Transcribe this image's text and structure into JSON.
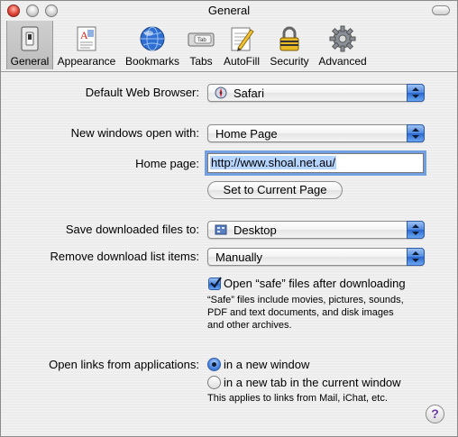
{
  "window": {
    "title": "General"
  },
  "toolbar": {
    "items": [
      {
        "label": "General",
        "icon": "switch-icon"
      },
      {
        "label": "Appearance",
        "icon": "appearance-icon"
      },
      {
        "label": "Bookmarks",
        "icon": "globe-icon"
      },
      {
        "label": "Tabs",
        "icon": "tabs-icon"
      },
      {
        "label": "AutoFill",
        "icon": "autofill-pencil-icon"
      },
      {
        "label": "Security",
        "icon": "lock-icon"
      },
      {
        "label": "Advanced",
        "icon": "gear-icon"
      }
    ],
    "tab_icon_text": "Tab"
  },
  "settings": {
    "default_browser": {
      "label": "Default Web Browser:",
      "value": "Safari"
    },
    "new_windows": {
      "label": "New windows open with:",
      "value": "Home Page"
    },
    "home_page": {
      "label": "Home page:",
      "value": "http://www.shoal.net.au/"
    },
    "set_current_button": "Set to Current Page",
    "save_downloads": {
      "label": "Save downloaded files to:",
      "value": "Desktop"
    },
    "remove_downloads": {
      "label": "Remove download list items:",
      "value": "Manually"
    },
    "open_safe": {
      "label": "Open “safe” files after downloading",
      "checked": true,
      "note_lines": [
        "“Safe” files include movies, pictures, sounds,",
        "PDF and text documents, and disk images",
        "and other archives."
      ]
    },
    "open_links": {
      "label": "Open links from applications:",
      "options": [
        "in a new window",
        "in a new tab in the current window"
      ],
      "selected": "in a new window",
      "note": "This applies to links from Mail, iChat, etc."
    }
  },
  "help": {
    "label": "?"
  },
  "colors": {
    "accent": "#4f88e0",
    "selection": "#b5d5ff",
    "focus_ring": "#5c92e0"
  }
}
